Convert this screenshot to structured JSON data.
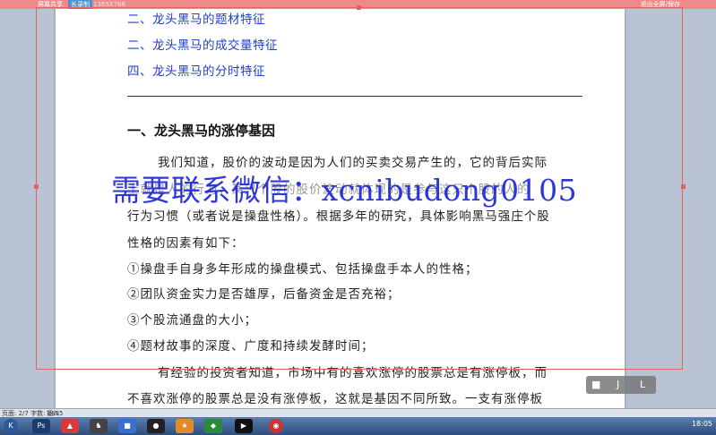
{
  "topbar": {
    "left_text": "屏幕共享",
    "badge": "长录制",
    "resolution": "1365X768",
    "right_text": "退出全屏/保存"
  },
  "toc": [
    "二、龙头黑马的题材特征",
    "二、龙头黑马的成交量特征",
    "四、龙头黑马的分时特征"
  ],
  "section_heading": "一、龙头黑马的涨停基因",
  "paragraphs": [
    "我们知道，股价的波动是因为人们的买卖交易产生的，它的背后实际",
    "上就是人的行为，某只个股的股价波动就体现的是参与这只个股的人的",
    "行为习惯（或者说是操盘性格）。根据多年的研究，具体影响黑马强庄个股",
    "性格的因素有如下：",
    "①操盘手自身多年形成的操盘模式、包括操盘手本人的性格；",
    "②团队资金实力是否雄厚，后备资金是否充裕；",
    "③个股流通盘的大小；",
    "④题材故事的深度、广度和持续发酵时间；",
    "有经验的投资者知道，市场中有的喜欢涨停的股票总是有涨停板，而",
    "不喜欢涨停的股票总是没有涨停板，这就是基因不同所致。一支有涨停板"
  ],
  "watermark": "需要联系微信：xcnibudong0105",
  "float_panel": {
    "a": "J",
    "b": "L"
  },
  "statusbar": {
    "left": "页面: 2/7   字数: 1835",
    "mode": "插入"
  },
  "taskbar": {
    "icons": [
      "start",
      "ps",
      "app-red",
      "horse",
      "app-blue",
      "app-dark",
      "app-orange",
      "chrome"
    ],
    "tray_time": "18:05"
  }
}
